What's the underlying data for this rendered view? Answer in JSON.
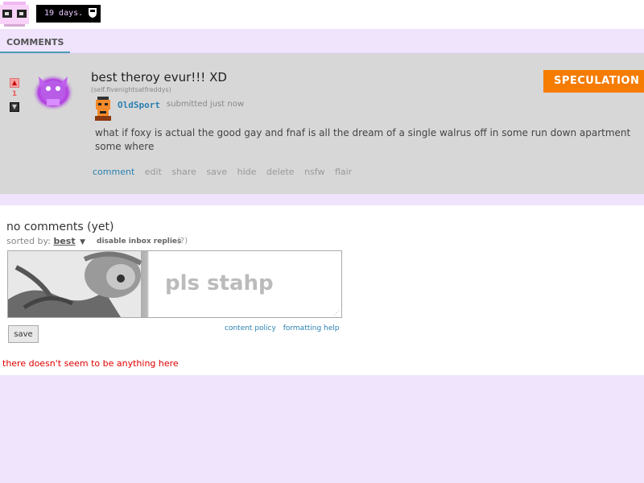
{
  "header": {
    "countdown": "19 days.",
    "shield_icon": "shield-icon"
  },
  "tabs": {
    "comments": "COMMENTS"
  },
  "post": {
    "score": "1",
    "title": "best theroy evur!!! XD",
    "domain": "(self.fivenightsatfreddys)",
    "author": "OldSport",
    "submitted": "submitted just now",
    "flair": "SPECULATION",
    "flair_color": "#f57c00",
    "selftext": "what if foxy is actual the good gay and fnaf is all the dream of a single walrus off in some run down apartment some where",
    "actions": [
      "comment",
      "edit",
      "share",
      "save",
      "hide",
      "delete",
      "nsfw",
      "flair"
    ]
  },
  "comments": {
    "heading": "no comments (yet)",
    "sorted_label": "sorted by:",
    "sorted_value": "best",
    "disable_inbox": "disable inbox replies",
    "help": "(?)",
    "textarea_placeholder": "pls stahp",
    "save_label": "save",
    "content_policy": "content policy",
    "formatting_help": "formatting help",
    "empty_message": "there doesn't seem to be anything here"
  }
}
